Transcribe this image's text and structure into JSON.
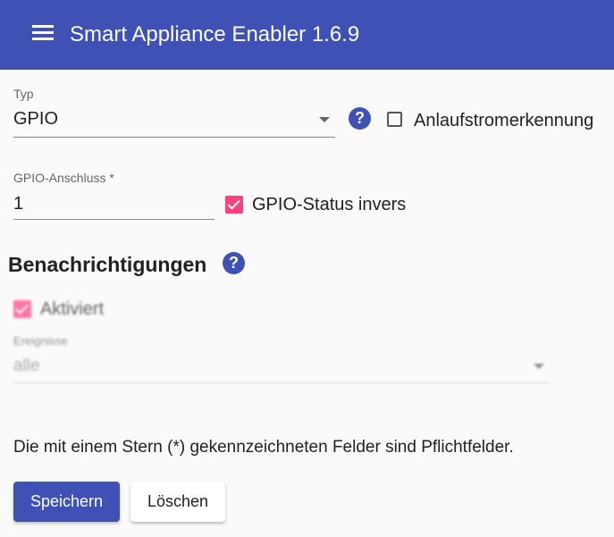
{
  "app": {
    "title": "Smart Appliance Enabler 1.6.9",
    "menu_icon": "menu-icon"
  },
  "typ": {
    "label": "Typ",
    "value": "GPIO",
    "help_icon": "help-icon"
  },
  "anlaufstrom": {
    "label": "Anlaufstromerkennung",
    "checked": false
  },
  "gpio_anschluss": {
    "label": "GPIO-Anschluss *",
    "value": "1"
  },
  "gpio_status": {
    "label": "GPIO-Status invers",
    "checked": true
  },
  "benachrichtigungen": {
    "heading": "Benachrichtigungen",
    "help_icon": "help-icon",
    "aktiviert": {
      "label": "Aktiviert",
      "checked": true
    },
    "ereignisse": {
      "label": "Ereignisse",
      "value": "alle"
    }
  },
  "footer": {
    "note": "Die mit einem Stern (*) gekennzeichneten Felder sind Pflichtfelder.",
    "save_label": "Speichern",
    "delete_label": "Löschen"
  },
  "colors": {
    "primary": "#3f51b5",
    "accent": "#ff4081"
  }
}
